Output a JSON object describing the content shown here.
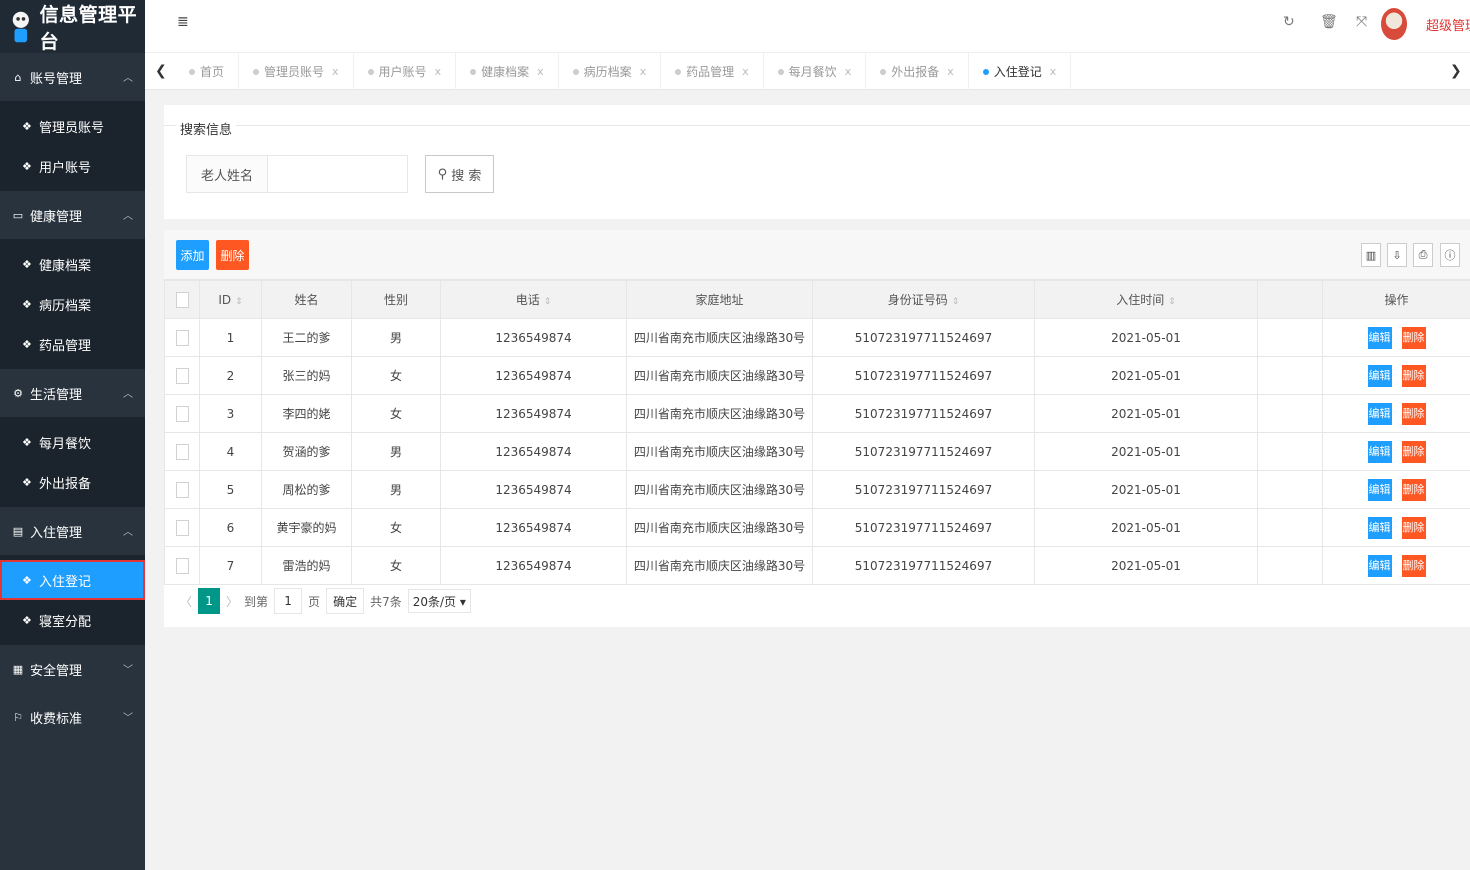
{
  "app": {
    "title": "信息管理平台"
  },
  "sidebar": {
    "groups": [
      {
        "label": "账号管理",
        "icon": "home-icon",
        "expanded": true,
        "items": [
          "管理员账号",
          "用户账号"
        ]
      },
      {
        "label": "健康管理",
        "icon": "monitor-icon",
        "expanded": true,
        "items": [
          "健康档案",
          "病历档案",
          "药品管理"
        ]
      },
      {
        "label": "生活管理",
        "icon": "cogs-icon",
        "expanded": true,
        "items": [
          "每月餐饮",
          "外出报备"
        ]
      },
      {
        "label": "入住管理",
        "icon": "file-icon",
        "expanded": true,
        "items": [
          "入住登记",
          "寝室分配"
        ]
      },
      {
        "label": "安全管理",
        "icon": "calendar-icon",
        "expanded": false,
        "items": []
      },
      {
        "label": "收费标准",
        "icon": "flag-icon",
        "expanded": false,
        "items": []
      }
    ],
    "active_item": "入住登记"
  },
  "header": {
    "menu_icon": "≣",
    "refresh_icon": "↻",
    "clear_icon": "🗑",
    "fullscreen_icon": "⤧",
    "username": "超级管理"
  },
  "tabs": {
    "items": [
      "首页",
      "管理员账号",
      "用户账号",
      "健康档案",
      "病历档案",
      "药品管理",
      "每月餐饮",
      "外出报备",
      "入住登记"
    ],
    "active": "入住登记",
    "close_glyph": "x",
    "prev": "❮",
    "next": "❯"
  },
  "search": {
    "legend": "搜索信息",
    "label": "老人姓名",
    "value": "",
    "button": "搜 索",
    "button_icon": "⚲"
  },
  "toolbar": {
    "add": "添加",
    "delete": "删除",
    "tools": [
      "▥",
      "⇩",
      "⎙",
      "ⓘ"
    ]
  },
  "table": {
    "columns": [
      "ID",
      "姓名",
      "性别",
      "电话",
      "家庭地址",
      "身份证号码",
      "入住时间",
      "",
      "操作"
    ],
    "rows": [
      {
        "id": "1",
        "name": "王二的爹",
        "sex": "男",
        "phone": "1236549874",
        "address": "四川省南充市顺庆区油缘路30号",
        "idcard": "510723197711524697",
        "date": "2021-05-01"
      },
      {
        "id": "2",
        "name": "张三的妈",
        "sex": "女",
        "phone": "1236549874",
        "address": "四川省南充市顺庆区油缘路30号",
        "idcard": "510723197711524697",
        "date": "2021-05-01"
      },
      {
        "id": "3",
        "name": "李四的姥",
        "sex": "女",
        "phone": "1236549874",
        "address": "四川省南充市顺庆区油缘路30号",
        "idcard": "510723197711524697",
        "date": "2021-05-01"
      },
      {
        "id": "4",
        "name": "贺涵的爹",
        "sex": "男",
        "phone": "1236549874",
        "address": "四川省南充市顺庆区油缘路30号",
        "idcard": "510723197711524697",
        "date": "2021-05-01"
      },
      {
        "id": "5",
        "name": "周松的爹",
        "sex": "男",
        "phone": "1236549874",
        "address": "四川省南充市顺庆区油缘路30号",
        "idcard": "510723197711524697",
        "date": "2021-05-01"
      },
      {
        "id": "6",
        "name": "黄宇豪的妈",
        "sex": "女",
        "phone": "1236549874",
        "address": "四川省南充市顺庆区油缘路30号",
        "idcard": "510723197711524697",
        "date": "2021-05-01"
      },
      {
        "id": "7",
        "name": "雷浩的妈",
        "sex": "女",
        "phone": "1236549874",
        "address": "四川省南充市顺庆区油缘路30号",
        "idcard": "510723197711524697",
        "date": "2021-05-01"
      }
    ],
    "edit_label": "编辑",
    "delete_label": "删除",
    "sort_glyph": "⇕"
  },
  "pager": {
    "prev": "〈",
    "next": "〉",
    "current": "1",
    "goto_label": "到第",
    "goto_value": "1",
    "page_suffix": "页",
    "confirm": "确定",
    "total": "共7条",
    "page_size": "20条/页 ▾"
  },
  "colors": {
    "primary": "#1E9FFF",
    "danger": "#FF5722",
    "pager_active": "#009688",
    "sidebar_bg": "#28333e",
    "highlight": "#e23535"
  }
}
